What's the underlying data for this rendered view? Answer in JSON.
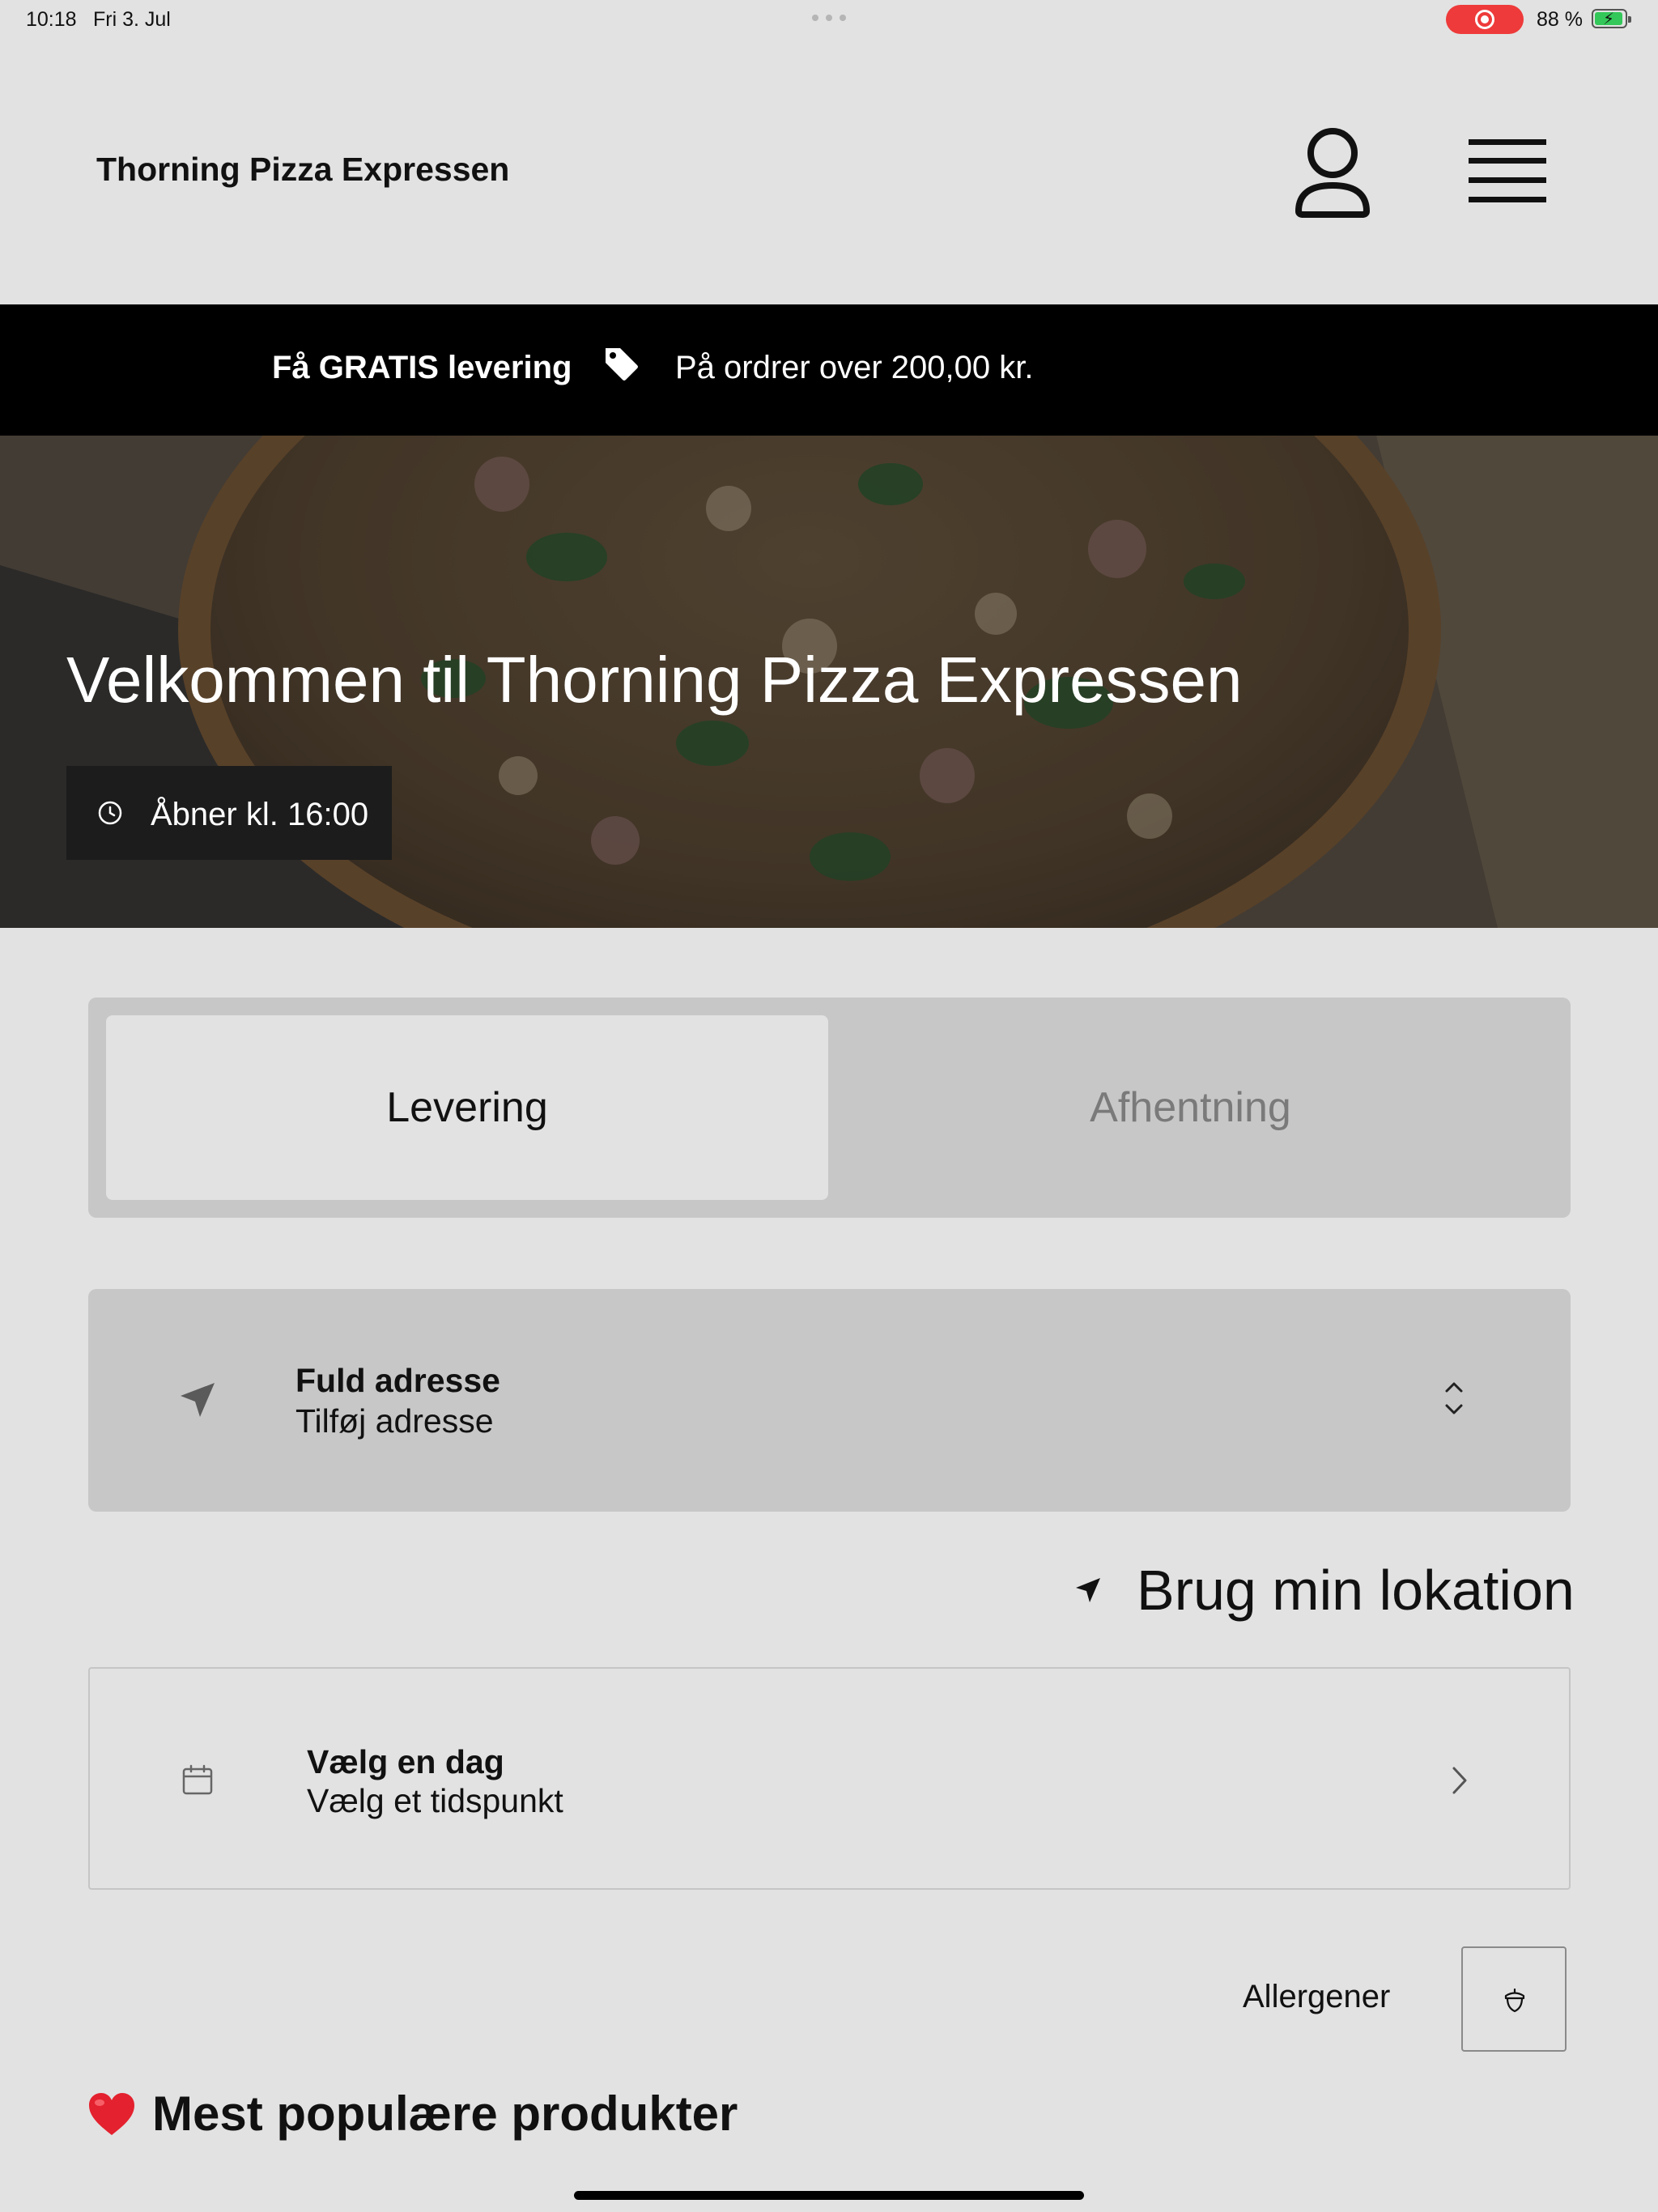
{
  "status_bar": {
    "time": "10:18",
    "date": "Fri 3. Jul",
    "battery_percent": "88 %",
    "recording_color": "#ee3a3a",
    "battery_color": "#34c759"
  },
  "header": {
    "brand": "Thorning Pizza Expressen",
    "user_icon": "user-icon",
    "menu_icon": "hamburger-menu-icon"
  },
  "promo": {
    "strong": "Få GRATIS levering",
    "icon": "price-tag-icon",
    "text": "På ordrer over 200,00 kr."
  },
  "hero": {
    "title": "Velkommen til Thorning Pizza Expressen",
    "opening_icon": "clock-icon",
    "opening_text": "Åbner kl. 16:00"
  },
  "order_type": {
    "options": [
      "Levering",
      "Afhentning"
    ],
    "selected": "Levering"
  },
  "address": {
    "icon": "location-arrow-icon",
    "label": "Fuld adresse",
    "value": "Tilføj adresse",
    "toggle_icon": "chevron-up-down-icon"
  },
  "use_location": {
    "icon": "location-arrow-icon",
    "label": "Brug min lokation"
  },
  "schedule": {
    "icon": "calendar-icon",
    "label": "Vælg en dag",
    "value": "Vælg et tidspunkt",
    "chevron_icon": "chevron-right-icon"
  },
  "allergens": {
    "label": "Allergener",
    "icon": "acorn-icon"
  },
  "popular": {
    "icon": "heart-emoji-icon",
    "heading": "Mest populære produkter"
  },
  "colors": {
    "background": "#e2e2e2",
    "promo_background": "#000000",
    "control_background": "#c7c7c7",
    "heart": "#e4212e"
  }
}
